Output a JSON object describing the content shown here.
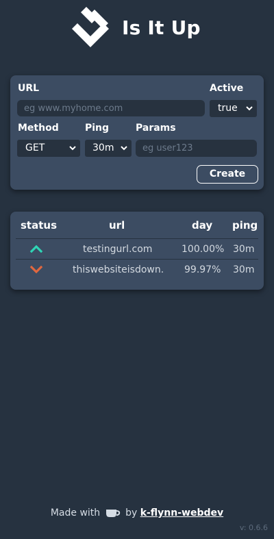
{
  "app": {
    "title": "Is It Up"
  },
  "form": {
    "url_label": "URL",
    "url_placeholder": "eg www.myhome.com",
    "active_label": "Active",
    "active_value": "true",
    "method_label": "Method",
    "method_value": "GET",
    "ping_label": "Ping",
    "ping_value": "30m",
    "params_label": "Params",
    "params_placeholder": "eg user123",
    "create_label": "Create"
  },
  "table": {
    "headers": {
      "status": "status",
      "url": "url",
      "day": "day",
      "ping": "ping"
    },
    "rows": [
      {
        "status": "up",
        "status_icon": "chevron-up-icon",
        "status_color": "#2fd5b5",
        "url": "testingurl.com",
        "day": "100.00%",
        "ping": "30m"
      },
      {
        "status": "down",
        "status_icon": "chevron-down-icon",
        "status_color": "#e0673f",
        "url": "thiswebsiteisdown.",
        "day": "99.97%",
        "ping": "30m"
      }
    ]
  },
  "footer": {
    "made_with": "Made with",
    "by": "by",
    "author": "k-flynn-webdev",
    "cup_icon": "coffee-cup-icon"
  },
  "version": "v: 0.6.6"
}
